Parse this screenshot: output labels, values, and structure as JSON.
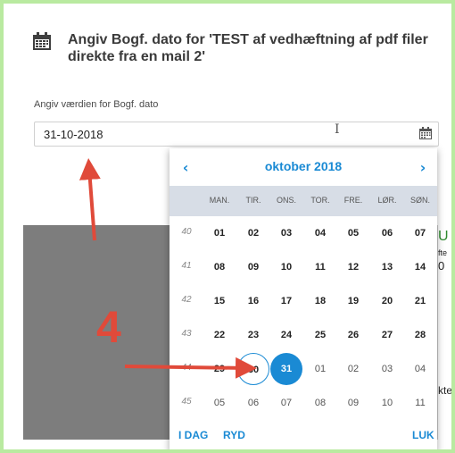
{
  "dialog": {
    "title": "Angiv Bogf. dato for 'TEST af vedhæftning af pdf filer direkte fra en mail 2'",
    "field_label": "Angiv værdien for Bogf. dato",
    "field_value": "31-10-2018",
    "title_icon": "calendar-icon",
    "input_icon": "calendar-icon"
  },
  "datepicker": {
    "month_label": "oktober 2018",
    "prev_label": "‹",
    "next_label": "›",
    "weekdays": [
      "MAN.",
      "TIR.",
      "ONS.",
      "TOR.",
      "FRE.",
      "LØR.",
      "SØN."
    ],
    "weeks": [
      {
        "num": "40",
        "days": [
          "01",
          "02",
          "03",
          "04",
          "05",
          "06",
          "07"
        ]
      },
      {
        "num": "41",
        "days": [
          "08",
          "09",
          "10",
          "11",
          "12",
          "13",
          "14"
        ]
      },
      {
        "num": "42",
        "days": [
          "15",
          "16",
          "17",
          "18",
          "19",
          "20",
          "21"
        ]
      },
      {
        "num": "43",
        "days": [
          "22",
          "23",
          "24",
          "25",
          "26",
          "27",
          "28"
        ]
      },
      {
        "num": "44",
        "days": [
          "29",
          "30",
          "31",
          "01",
          "02",
          "03",
          "04"
        ]
      },
      {
        "num": "45",
        "days": [
          "05",
          "06",
          "07",
          "08",
          "09",
          "10",
          "11"
        ]
      }
    ],
    "today_label": "I DAG",
    "clear_label": "RYD",
    "close_label": "LUK",
    "today_date": "30",
    "selected_date": "31"
  },
  "background": {
    "edge_texts": [
      "U",
      "fte",
      "0",
      "kte"
    ]
  },
  "annotation": {
    "step_number": "4",
    "arrow_color": "#e04a3a"
  },
  "colors": {
    "accent": "#1a8ad4",
    "weekday_bar": "#d7dde6",
    "backdrop": "#7d7d7d",
    "page_border": "#b9eaa0"
  }
}
